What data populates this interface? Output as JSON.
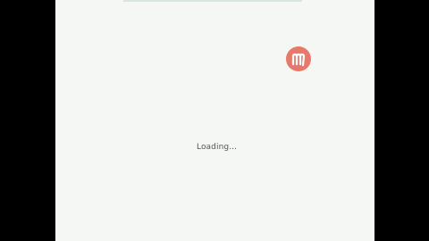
{
  "status": {
    "loading_label": "Loading..."
  },
  "logo": {
    "icon": "brand-logo-icon",
    "color": "#e8796a"
  },
  "colors": {
    "letterbox": "#000000",
    "page_background": "#f4f7f3"
  }
}
